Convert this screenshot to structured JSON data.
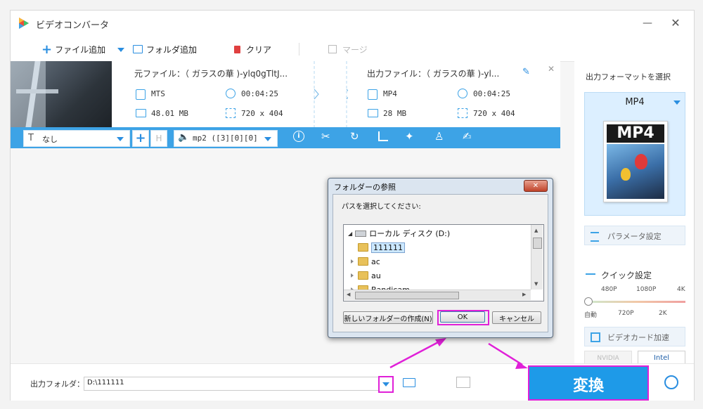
{
  "app": {
    "title": "ビデオコンバータ"
  },
  "toolbar": {
    "add_file": "ファイル追加",
    "add_folder": "フォルダ追加",
    "clear": "クリア",
    "merge": "マージ"
  },
  "file": {
    "source_name": "元ファイル：（ ガラスの華 )-ylq0gTltJ...",
    "source_format": "MTS",
    "source_duration": "00:04:25",
    "source_size": "48.01 MB",
    "source_resolution": "720 x 404",
    "output_name": "出力ファイル：（ ガラスの華 )-yl...",
    "output_format": "MP4",
    "output_duration": "00:04:25",
    "output_size": "28 MB",
    "output_resolution": "720 x 404"
  },
  "editbar": {
    "subtitle_value": "なし",
    "audio_value": "mp2 ([3][0][0]"
  },
  "right_panel": {
    "format_header": "出力フォーマットを選択",
    "format_name": "MP4",
    "format_logo": "MP4",
    "param_settings": "パラメータ設定",
    "quick_settings": "クイック設定",
    "quality_top": [
      "480P",
      "1080P",
      "4K"
    ],
    "quality_bottom": [
      "自動",
      "720P",
      "2K"
    ],
    "gpu_accel": "ビデオカード加速",
    "nvidia": "NVIDIA",
    "intel": "Intel"
  },
  "bottom": {
    "output_folder_label": "出力フォルダ：",
    "output_folder_value": "D:\\111111",
    "convert": "変換"
  },
  "dialog": {
    "title": "フォルダーの参照",
    "prompt": "パスを選択してください:",
    "drive": "ローカル ディスク (D:)",
    "folders": [
      "111111",
      "ac",
      "au",
      "Bandicam"
    ],
    "new_folder": "新しいフォルダーの作成(N)",
    "ok": "OK",
    "cancel": "キャンセル"
  },
  "colors": {
    "accent": "#3da3e6",
    "convert_bg": "#1e9ae8",
    "highlight": "#e020d8",
    "format_card_bg": "#dcefff"
  }
}
